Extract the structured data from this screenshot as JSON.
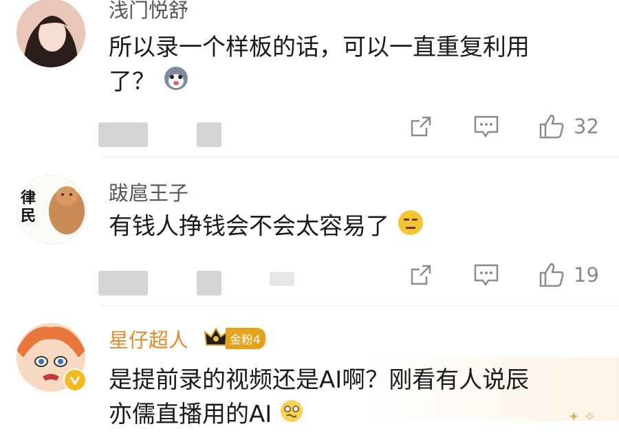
{
  "comments": [
    {
      "username": "浅门悦舒",
      "text_line1": "所以录一个样板的话，可以一直重复利用",
      "text_line2": "了？",
      "emoji": "husky-emoji",
      "like_count": "32"
    },
    {
      "username": "跋扈王子",
      "avatar_text": [
        "律",
        "民"
      ],
      "text_line1": "有钱人挣钱会不会太容易了",
      "emoji": "meh-face-emoji",
      "like_count": "19"
    },
    {
      "username": "星仔超人",
      "fan_badge": "金粉4",
      "text_line1": "是提前录的视频还是AI啊？刚看有人说辰",
      "text_line2": "亦儒直播用的AI",
      "emoji": "nervous-face-emoji"
    }
  ],
  "colors": {
    "username_gold": "#e4892c",
    "icon_gray": "#8a8a8a",
    "badge_gold": "#e8a21a"
  }
}
